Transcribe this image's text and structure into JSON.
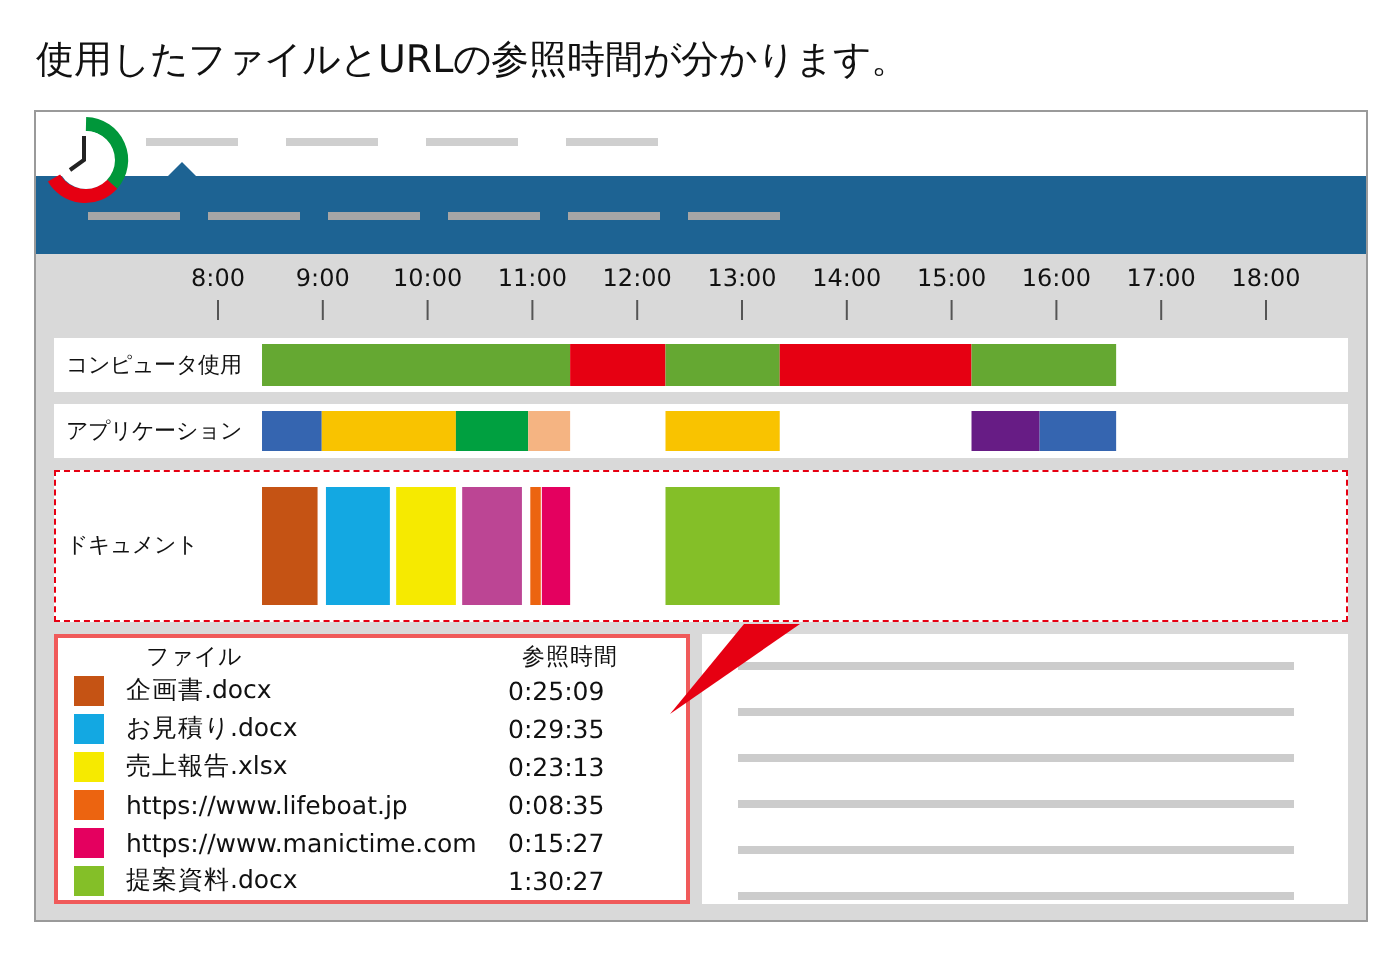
{
  "heading": "使用したファイルとURLの参照時間が分かります。",
  "timeline": {
    "ticks": [
      "8:00",
      "9:00",
      "10:00",
      "11:00",
      "12:00",
      "13:00",
      "14:00",
      "15:00",
      "16:00",
      "17:00",
      "18:00"
    ],
    "rows": [
      {
        "label": "コンピュータ使用",
        "selected": false
      },
      {
        "label": "アプリケーション",
        "selected": false
      },
      {
        "label": "ドキュメント",
        "selected": true
      }
    ]
  },
  "file_panel": {
    "columns": [
      "ファイル",
      "参照時間"
    ],
    "rows": [
      {
        "name": "企画書.docx",
        "time": "0:25:09",
        "color": "#c55314"
      },
      {
        "name": "お見積り.docx",
        "time": "0:29:35",
        "color": "#13a8e2"
      },
      {
        "name": "売上報告.xlsx",
        "time": "0:23:13",
        "color": "#f6ea00"
      },
      {
        "name": "https://www.lifeboat.jp",
        "time": "0:08:35",
        "color": "#ec6410"
      },
      {
        "name": "https://www.manictime.com",
        "time": "0:15:27",
        "color": "#e4005f"
      },
      {
        "name": "提案資料.docx",
        "time": "1:30:27",
        "color": "#84bf28"
      }
    ]
  }
}
